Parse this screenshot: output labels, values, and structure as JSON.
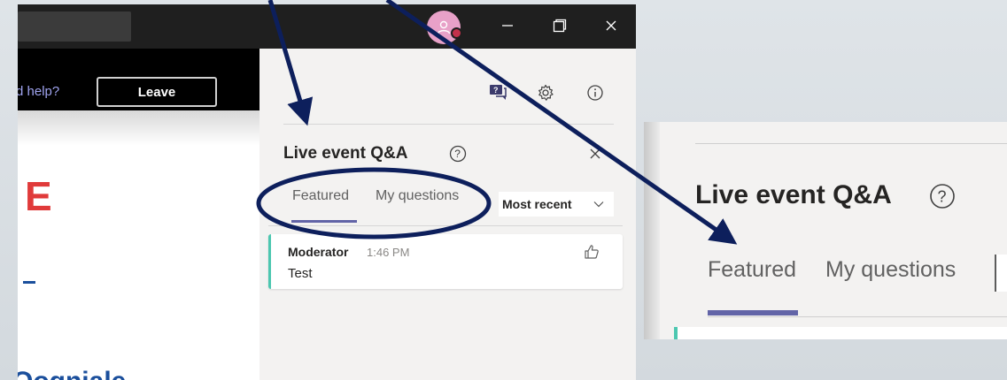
{
  "stage": {
    "help_text": "d help?",
    "leave_label": "Leave",
    "letter": "E",
    "partial_text": "Oogniale"
  },
  "panel": {
    "title": "Live event Q&A",
    "tabs": [
      {
        "label": "Featured",
        "active": true
      },
      {
        "label": "My questions",
        "active": false
      }
    ],
    "sort_label": "Most recent",
    "question": {
      "author": "Moderator",
      "time": "1:46 PM",
      "text": "Test"
    }
  },
  "inset": {
    "title": "Live event Q&A",
    "tabs": [
      {
        "label": "Featured",
        "active": true
      },
      {
        "label": "My questions",
        "active": false
      }
    ],
    "select_partial": "I"
  },
  "colors": {
    "accent": "#6264a7",
    "annotation": "#0d1f5c",
    "leave_bg": "#000000",
    "brand_red": "#e03a3a",
    "card_accent": "#4cc7b0"
  },
  "icons": [
    "avatar-icon",
    "minimize-icon",
    "maximize-icon",
    "close-icon",
    "qna-icon",
    "gear-icon",
    "info-icon",
    "help-icon",
    "chevron-down-icon",
    "like-icon"
  ]
}
